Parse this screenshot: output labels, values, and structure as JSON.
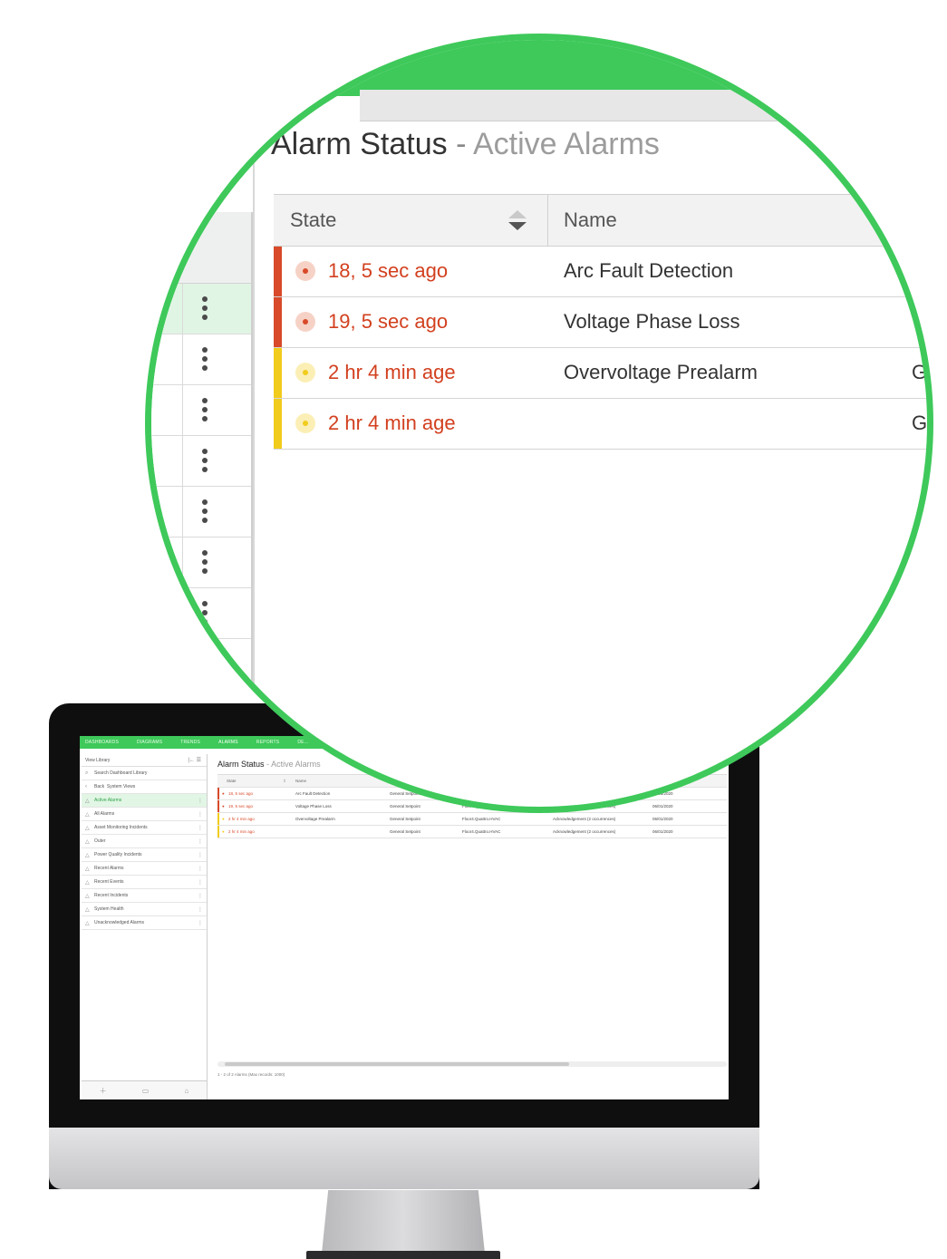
{
  "colors": {
    "accent_green": "#3ec95a",
    "critical": "#d84a2a",
    "warning": "#f1cc1c"
  },
  "monitor_screen": {
    "nav_tabs": [
      "DASHBOARDS",
      "DIAGRAMS",
      "TRENDS",
      "ALARMS",
      "REPORTS",
      "DE..."
    ],
    "active_nav": "ALARMS",
    "sidebar": {
      "header": "View Library",
      "header_icons": [
        "|←",
        "☰"
      ],
      "search": "Search Dashboard Library",
      "breadcrumb": [
        "Back",
        "System Views"
      ],
      "items": [
        {
          "label": "Active Alarms",
          "active": true
        },
        {
          "label": "All Alarms"
        },
        {
          "label": "Asset Monitoring Incidents"
        },
        {
          "label": "Outer"
        },
        {
          "label": "Power Quality Incidents"
        },
        {
          "label": "Recent Alarms"
        },
        {
          "label": "Recent Events"
        },
        {
          "label": "Recent Incidents"
        },
        {
          "label": "System Health"
        },
        {
          "label": "Unacknowledged Alarms"
        }
      ],
      "footer_icons": [
        "plus-icon",
        "folder-icon",
        "home-icon"
      ]
    },
    "main": {
      "title": "Alarm Status",
      "title_sep": "-",
      "subtitle": "Active Alarms",
      "columns": [
        "State",
        "Name"
      ],
      "rows": [
        {
          "state": "18, 5 sec ago",
          "name": "Arc Fault Detection",
          "type": "General Setpoint",
          "source": "",
          "ack": "Acknowledgement (2 occurrences)",
          "date": "06/01/2020",
          "severity": "critical"
        },
        {
          "state": "19, 5 sec ago",
          "name": "Voltage Phase Loss",
          "type": "General Setpoint",
          "source": "Floor4.Quattro.HVAC",
          "ack": "Acknowledgement (2 occurrences)",
          "date": "06/01/2020",
          "severity": "critical"
        },
        {
          "state": "2 hr 4 min ago",
          "name": "Overvoltage Prealarm",
          "type": "General Setpoint",
          "source": "Floor4.Quattro.HVAC",
          "ack": "Acknowledgement (2 occurrences)",
          "date": "06/01/2020",
          "severity": "warning"
        },
        {
          "state": "2 hr 4 min ago",
          "name": "",
          "type": "General Setpoint",
          "source": "Floor4.Quattro.HVAC",
          "ack": "Acknowledgement (2 occurrences)",
          "date": "06/01/2020",
          "severity": "warning"
        }
      ],
      "status": "1 - 2 of 2 Alarms (Max records: 1000)"
    }
  },
  "zoom": {
    "title": "Alarm Status",
    "title_sep": "-",
    "subtitle": "Active Alarms",
    "col_state": "State",
    "col_name": "Name",
    "rows": [
      {
        "state": "18, 5 sec ago",
        "name": "Arc Fault Detection",
        "extra": "",
        "severity": "critical"
      },
      {
        "state": "19, 5 sec ago",
        "name": "Voltage Phase Loss",
        "extra": "",
        "severity": "critical"
      },
      {
        "state": "2 hr 4 min age",
        "name": "Overvoltage Prealarm",
        "extra": "G",
        "severity": "warning"
      },
      {
        "state": "2 hr 4 min age",
        "name": "",
        "extra": "G",
        "severity": "warning"
      }
    ]
  }
}
